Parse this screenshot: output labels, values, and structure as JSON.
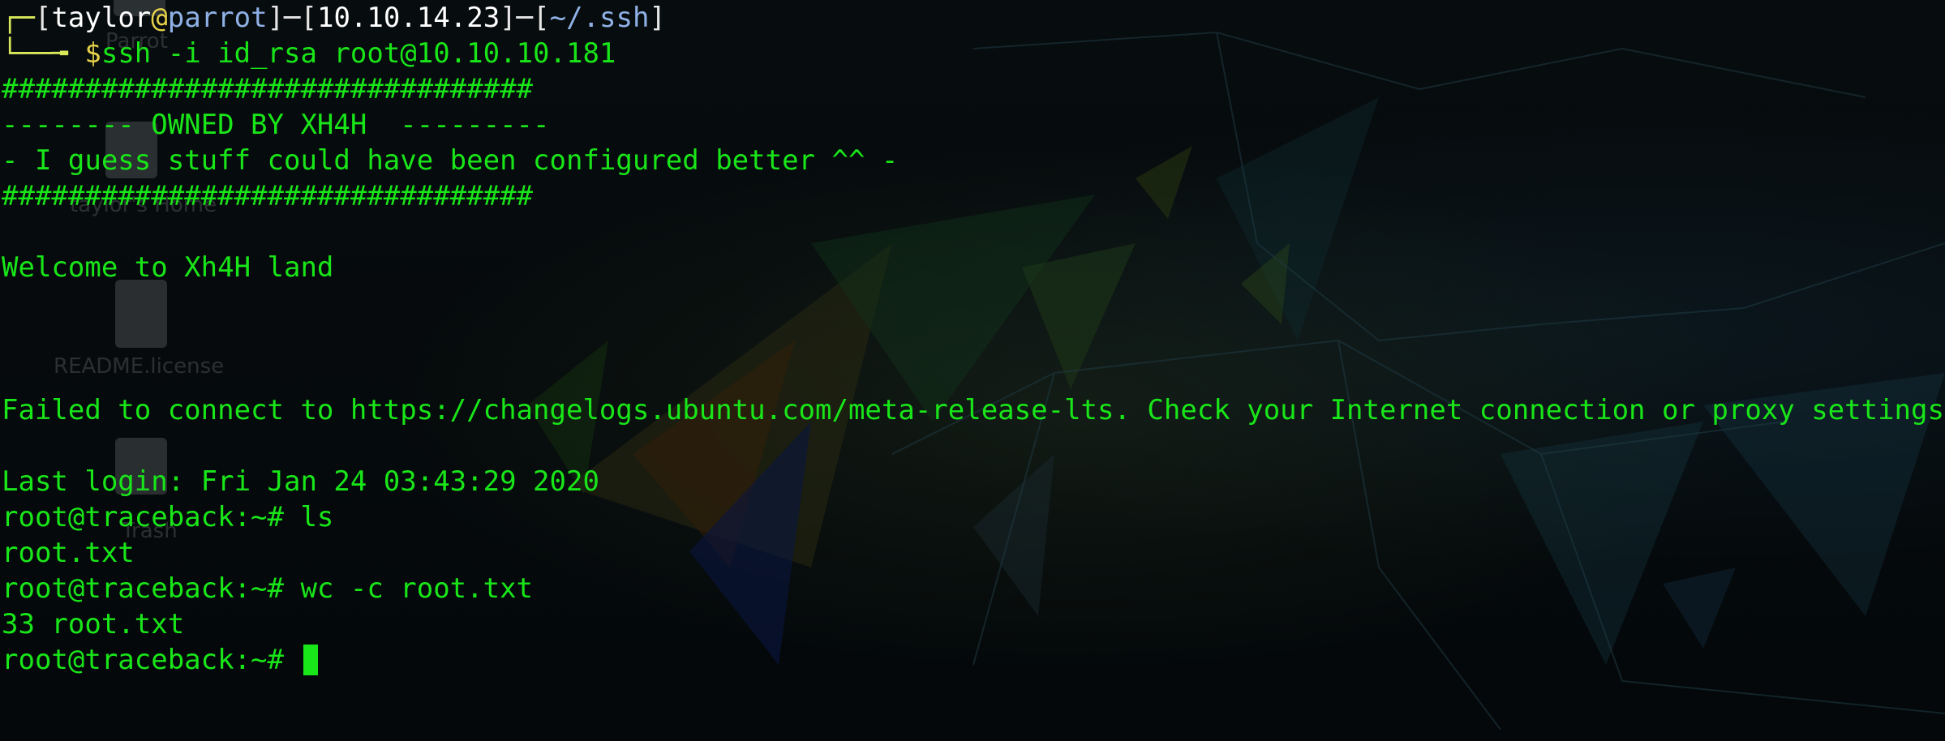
{
  "desktop": {
    "icons": [
      {
        "label": "Parrot",
        "icon": "parrot-folder-icon"
      },
      {
        "label": "taylor's Home",
        "icon": "home-folder-icon"
      },
      {
        "label": "README.license",
        "icon": "text-file-icon"
      },
      {
        "label": "Trash",
        "icon": "trash-icon"
      }
    ]
  },
  "prompt": {
    "corner_top": "┌─",
    "corner_bottom": "└──╼ ",
    "user": "taylor",
    "at": "@",
    "host": "parrot",
    "ip": "10.10.14.23",
    "cwd": "~/.ssh",
    "dollar": "$",
    "command": "ssh -i id_rsa root@10.10.10.181",
    "sep": "]─[",
    "open": "[",
    "close": "]"
  },
  "output": {
    "banner_hash_1": "################################",
    "banner_owned": "-------- OWNED BY XH4H  ---------",
    "banner_guess": "- I guess stuff could have been configured better ^^ -",
    "banner_hash_2": "################################",
    "welcome": "Welcome to Xh4H land",
    "failed": "Failed to connect to https://changelogs.ubuntu.com/meta-release-lts. Check your Internet connection or proxy settings",
    "last_login": "Last login: Fri Jan 24 03:43:29 2020",
    "cmd1": "root@traceback:~# ls",
    "out1": "root.txt",
    "cmd2": "root@traceback:~# wc -c root.txt",
    "out2": "33 root.txt",
    "prompt_final": "root@traceback:~# "
  },
  "colors": {
    "terminal_text": "#19e619",
    "prompt_user": "#ffffff",
    "prompt_at": "#e6d34a",
    "prompt_host": "#8fb1e6",
    "background": "#05090b"
  }
}
